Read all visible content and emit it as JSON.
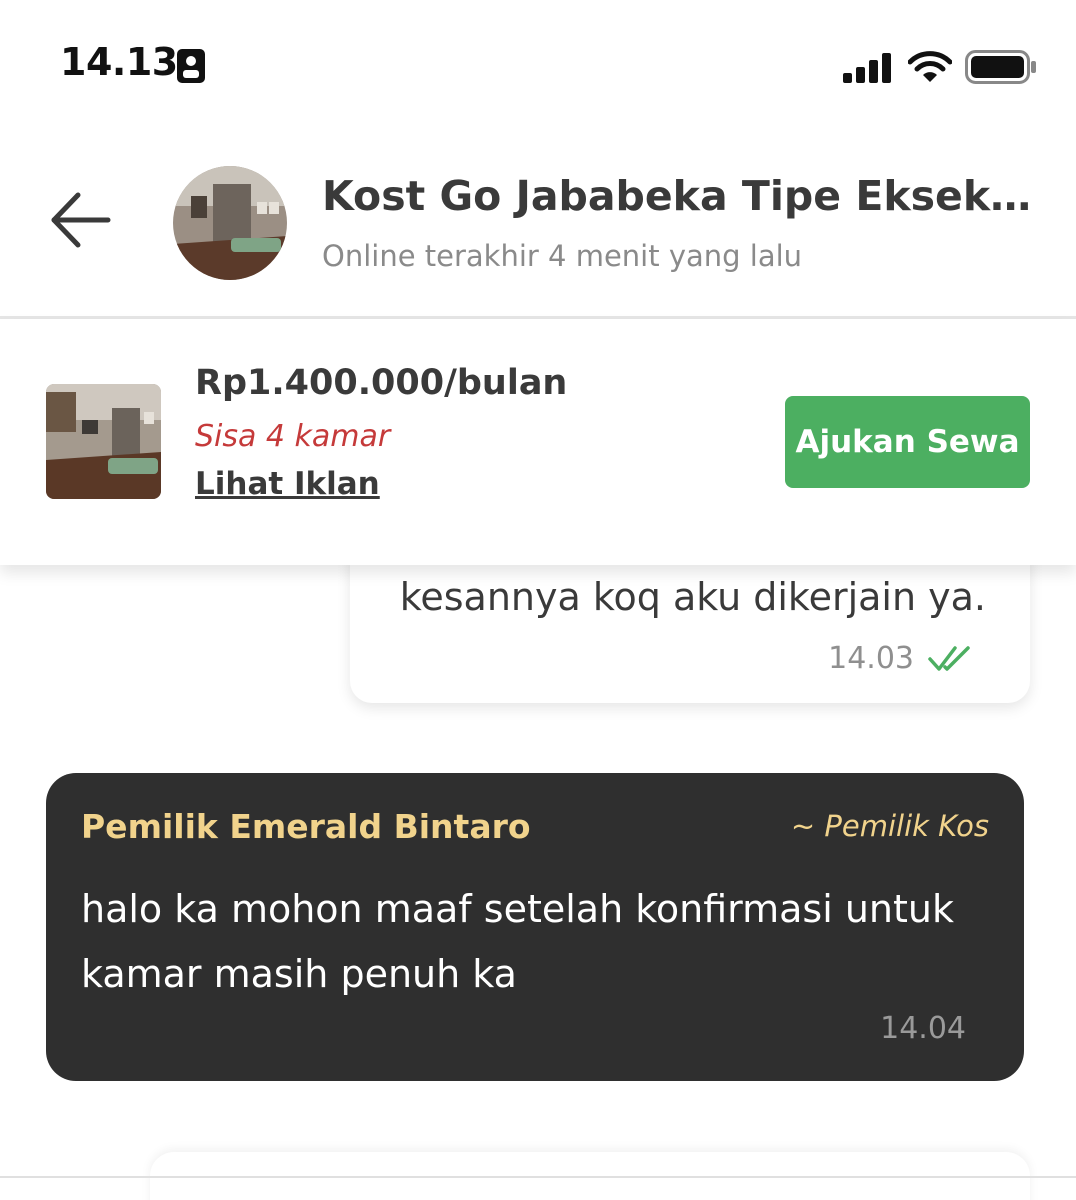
{
  "status_bar": {
    "time": "14.13"
  },
  "header": {
    "title": "Kost Go Jababeka Tipe Eksekutif…",
    "subtitle": "Online terakhir 4 menit yang lalu"
  },
  "listing": {
    "price": "Rp1.400.000/bulan",
    "rooms_left": "Sisa 4 kamar",
    "view_link": "Lihat Iklan",
    "rent_button": "Ajukan Sewa"
  },
  "messages": {
    "outgoing": {
      "text": "kesannya koq aku dikerjain ya.",
      "time": "14.03"
    },
    "incoming": {
      "sender": "Pemilik Emerald Bintaro",
      "role": "~ Pemilik Kos",
      "text": "halo ka mohon maaf setelah konfirmasi untuk kamar masih penuh ka",
      "time": "14.04"
    }
  },
  "colors": {
    "accent_green": "#4caf61",
    "warning_red": "#c53a3a",
    "sender_gold": "#f1d38c",
    "incoming_bubble": "#2f2f2f"
  }
}
